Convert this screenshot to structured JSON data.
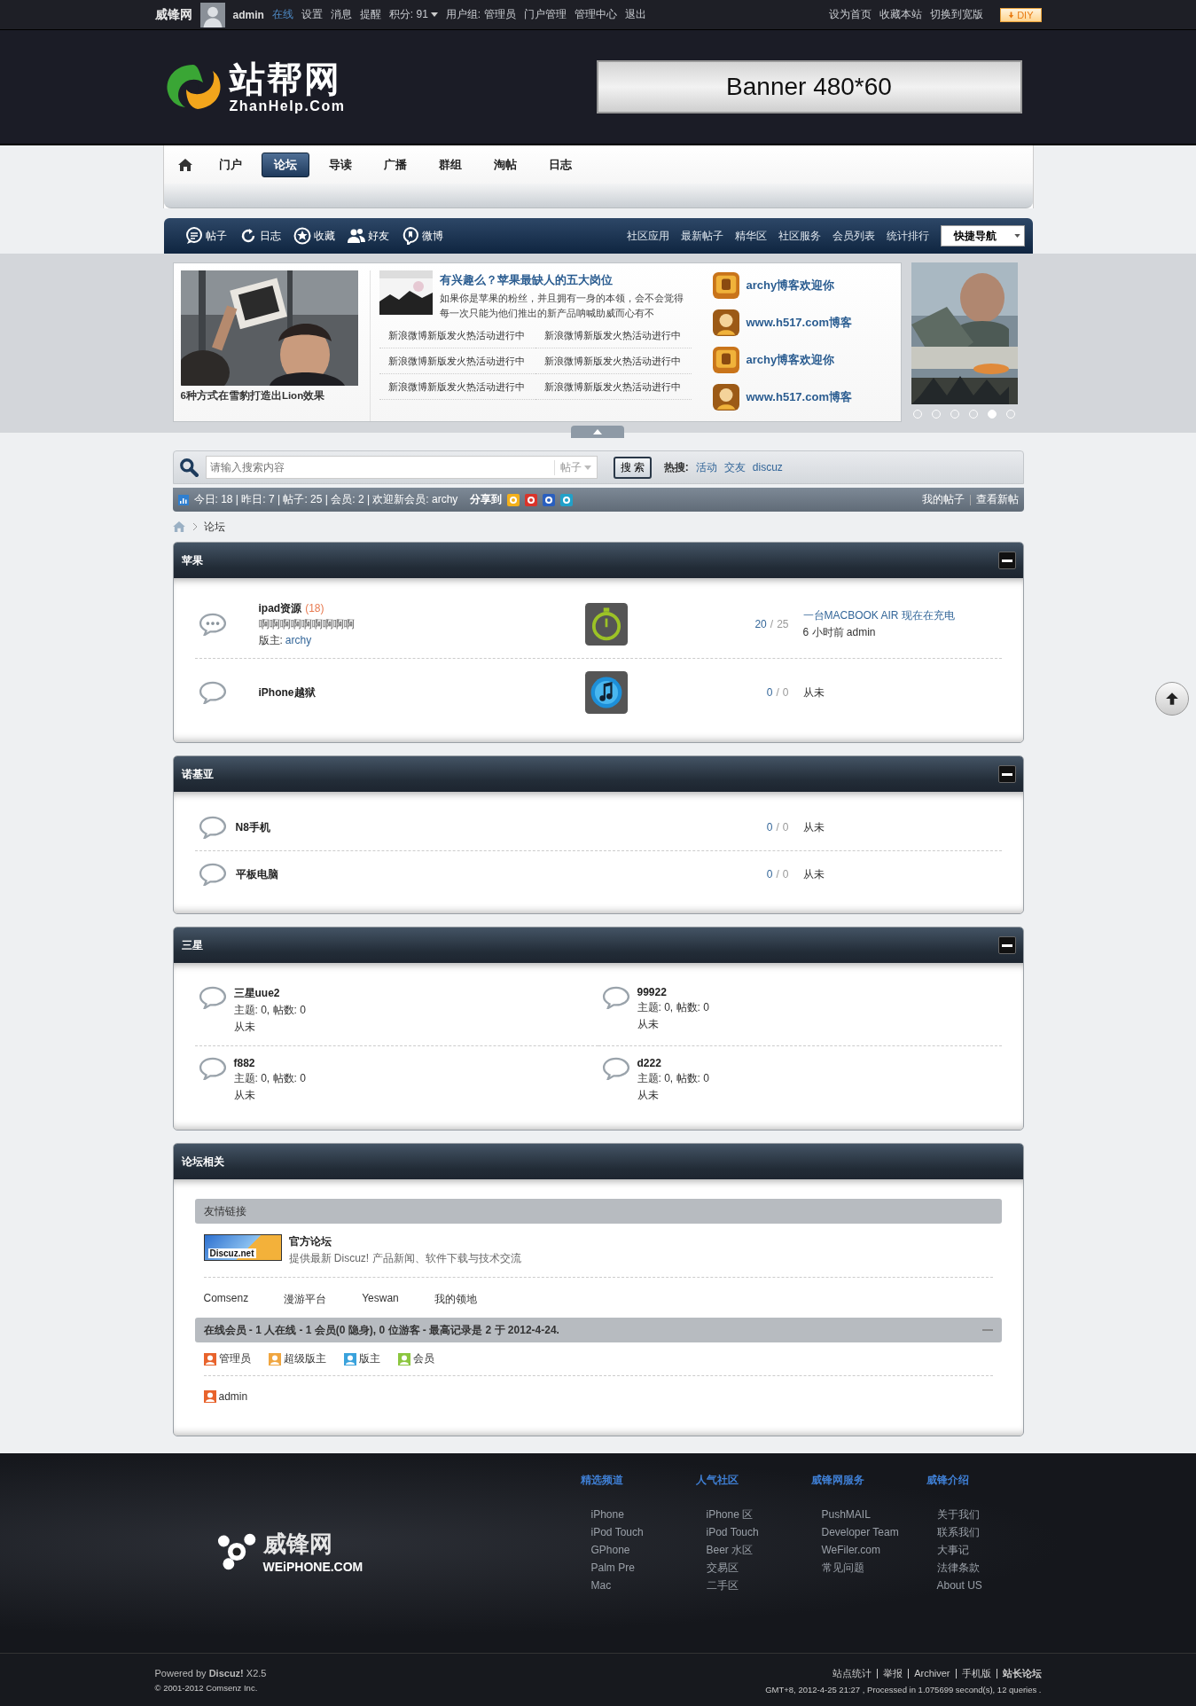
{
  "top_bar": {
    "site_name": "威锋网",
    "username": "admin",
    "status": "在线",
    "links": [
      "设置",
      "消息",
      "提醒"
    ],
    "credits": "积分: 91",
    "user_group": "用户组: 管理员",
    "admin_links": [
      "门户管理",
      "管理中心",
      "退出"
    ],
    "right_links": [
      "设为首页",
      "收藏本站",
      "切换到宽版"
    ],
    "diy_button": "DIY"
  },
  "header": {
    "logo_title": "站帮网",
    "logo_subtitle": "ZhanHelp.Com",
    "banner": "Banner 480*60"
  },
  "nav": [
    {
      "label": "门户",
      "selected": false
    },
    {
      "label": "论坛",
      "selected": true
    },
    {
      "label": "导读",
      "selected": false
    },
    {
      "label": "广播",
      "selected": false
    },
    {
      "label": "群组",
      "selected": false
    },
    {
      "label": "淘帖",
      "selected": false
    },
    {
      "label": "日志",
      "selected": false
    }
  ],
  "toolbar": {
    "left": [
      "帖子",
      "日志",
      "收藏",
      "好友",
      "微博"
    ],
    "right": [
      "社区应用",
      "最新帖子",
      "精华区",
      "社区服务",
      "会员列表",
      "统计排行"
    ],
    "quick_nav": "快捷导航"
  },
  "slider": {
    "photo_caption": "6种方式在雪豹打造出Lion效果",
    "headline": "有兴趣么？苹果最缺人的五大岗位",
    "summary": "如果你是苹果的粉丝，并且拥有一身的本领，会不会觉得每一次只能为他们推出的新产品呐喊助威而心有不",
    "news": [
      "新浪微博新版发火热活动进行中",
      "新浪微博新版发火热活动进行中",
      "新浪微博新版发火热活动进行中",
      "新浪微博新版发火热活动进行中",
      "新浪微博新版发火热活动进行中",
      "新浪微博新版发火热活动进行中"
    ],
    "blogs": [
      "archy博客欢迎你",
      "www.h517.com博客",
      "archy博客欢迎你",
      "www.h517.com博客"
    ],
    "pager": [
      {
        "selected": false
      },
      {
        "selected": false
      },
      {
        "selected": false
      },
      {
        "selected": false
      },
      {
        "selected": true
      },
      {
        "selected": false
      }
    ]
  },
  "search": {
    "placeholder": "请输入搜索内容",
    "scope": "帖子",
    "button": "搜 索",
    "hot_label": "热搜:",
    "hot": [
      "活动",
      "交友",
      "discuz"
    ]
  },
  "stats_bar": {
    "text": "今日: 18 | 昨日: 7 | 帖子: 25 | 会员: 2 | 欢迎新会员: archy",
    "share_label": "分享到",
    "links": [
      "我的帖子",
      "查看新帖"
    ]
  },
  "breadcrumb": [
    "论坛"
  ],
  "categories": [
    {
      "kind": "list",
      "title": "苹果",
      "collapsible": true,
      "show_images": true,
      "forums": [
        {
          "name": "ipad资源",
          "count": "(18)",
          "description": "啊啊啊啊啊啊啊啊啊",
          "moderator_label": "版主:",
          "moderator": "archy",
          "has_new": true,
          "topics": "20",
          "sep": "/",
          "posts": "25",
          "last_post": "一台MACBOOK AIR 现在在充电",
          "last_meta": "6 小时前 admin"
        },
        {
          "name": "iPhone越狱",
          "has_new": false,
          "topics": "0",
          "sep": "/",
          "posts": "0",
          "last_meta": "从未"
        }
      ]
    },
    {
      "kind": "list",
      "title": "诺基亚",
      "collapsible": true,
      "show_images": false,
      "forums": [
        {
          "name": "N8手机",
          "has_new": false,
          "topics": "0",
          "sep": "/",
          "posts": "0",
          "last_meta": "从未"
        },
        {
          "name": "平板电脑",
          "has_new": false,
          "topics": "0",
          "sep": "/",
          "posts": "0",
          "last_meta": "从未"
        }
      ]
    },
    {
      "kind": "grid",
      "title": "三星",
      "collapsible": true,
      "forums": [
        {
          "name": "三星uue2",
          "counts": "主题: 0, 帖数: 0",
          "last_meta": "从未",
          "has_new": false
        },
        {
          "name": "99922",
          "counts": "主题: 0, 帖数: 0",
          "last_meta": "从未",
          "has_new": false
        },
        {
          "name": "f882",
          "counts": "主题: 0, 帖数: 0",
          "last_meta": "从未",
          "has_new": false
        },
        {
          "name": "d222",
          "counts": "主题: 0, 帖数: 0",
          "last_meta": "从未",
          "has_new": false
        }
      ]
    }
  ],
  "forum_info": {
    "title": "论坛相关",
    "links_title": "友情链接",
    "featured": {
      "logo_text": "Discuz.net",
      "name": "官方论坛",
      "description": "提供最新 Discuz! 产品新闻、软件下载与技术交流"
    },
    "text_links": [
      "Comsenz",
      "漫游平台",
      "Yeswan",
      "我的领地"
    ],
    "online_summary": "在线会员 - 1 人在线 - 1 会员(0 隐身), 0 位游客 - 最高记录是 2 于 2012-4-24.",
    "legend": [
      {
        "label": "管理员",
        "color": "#e8632c"
      },
      {
        "label": "超级版主",
        "color": "#f0a640"
      },
      {
        "label": "版主",
        "color": "#3aa2dc"
      },
      {
        "label": "会员",
        "color": "#8cc63f"
      }
    ],
    "online_users": [
      {
        "name": "admin",
        "color": "#e8632c"
      }
    ]
  },
  "footer": {
    "logo_cn": "威锋网",
    "logo_en": "WEiPHONE.COM",
    "columns": [
      {
        "title": "精选频道",
        "links": [
          "iPhone",
          "iPod Touch",
          "GPhone",
          "Palm Pre",
          "Mac"
        ]
      },
      {
        "title": "人气社区",
        "links": [
          "iPhone 区",
          "iPod Touch",
          "Beer 水区",
          "交易区",
          "二手区"
        ]
      },
      {
        "title": "威锋网服务",
        "links": [
          "PushMAIL",
          "Developer Team",
          "WeFiler.com",
          "常见问题"
        ]
      },
      {
        "title": "威锋介绍",
        "links": [
          "关于我们",
          "联系我们",
          "大事记",
          "法律条款",
          "About US"
        ]
      }
    ],
    "powered": "Powered by **Discuz!** X2.5",
    "copyright": "© 2001-2012 Comsenz Inc.",
    "bottom_links": [
      {
        "label": "站点统计",
        "bold": false
      },
      {
        "label": "举报",
        "bold": false
      },
      {
        "label": "Archiver",
        "bold": false
      },
      {
        "label": "手机版",
        "bold": false
      },
      {
        "label": "站长论坛",
        "bold": true
      }
    ],
    "server_info": "GMT+8, 2012-4-25 21:27 , Processed in 1.075699 second(s), 12 queries ."
  }
}
